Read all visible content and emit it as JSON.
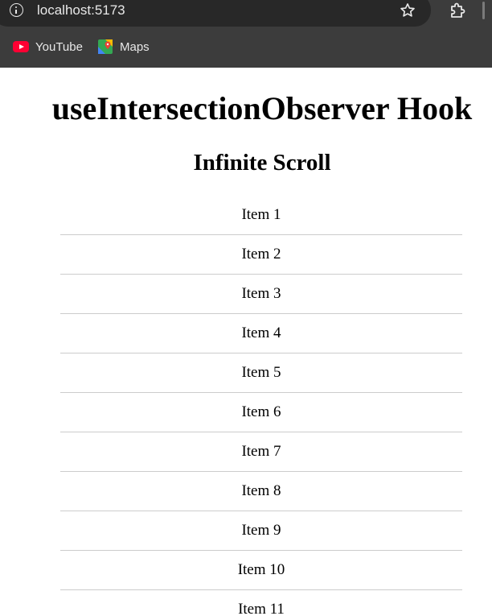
{
  "browser": {
    "url": "localhost:5173",
    "bookmarks": [
      {
        "label": "YouTube",
        "icon": "youtube-icon"
      },
      {
        "label": "Maps",
        "icon": "maps-icon"
      }
    ]
  },
  "page": {
    "title": "useIntersectionObserver Hook",
    "subtitle": "Infinite Scroll",
    "items": [
      "Item 1",
      "Item 2",
      "Item 3",
      "Item 4",
      "Item 5",
      "Item 6",
      "Item 7",
      "Item 8",
      "Item 9",
      "Item 10",
      "Item 11"
    ]
  },
  "colors": {
    "chrome_bg": "#3c3c3c",
    "omnibox_bg": "#282828",
    "divider": "#cccccc"
  }
}
